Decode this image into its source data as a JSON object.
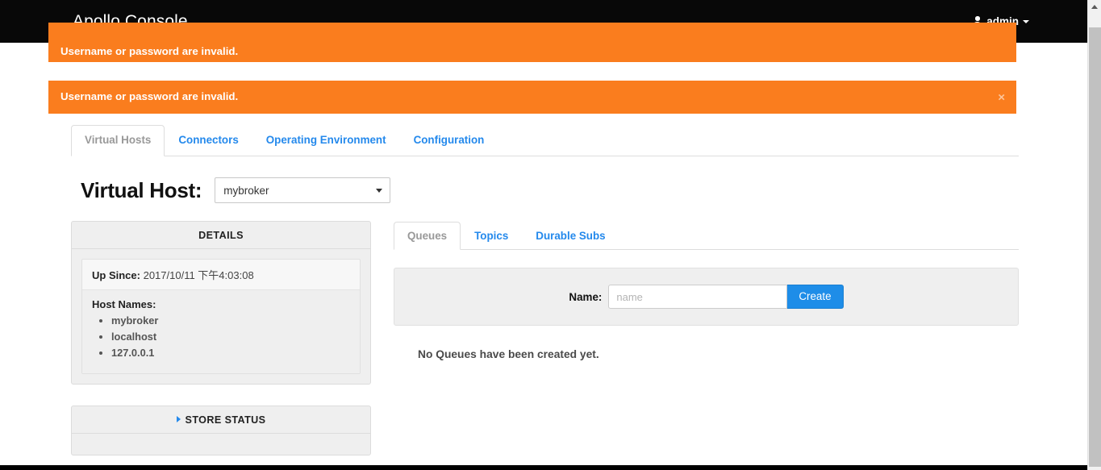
{
  "navbar": {
    "brand": "Apollo Console",
    "user_label": "admin",
    "user_icon": "user-icon",
    "caret_icon": "chevron-down-icon"
  },
  "alerts": [
    {
      "message": "Username or password are invalid.",
      "close_label": "×",
      "color": "#FA7D1E"
    },
    {
      "message": "Username or password are invalid.",
      "close_label": "×",
      "color": "#FA7D1E"
    }
  ],
  "main_tabs": [
    {
      "label": "Virtual Hosts",
      "active": true
    },
    {
      "label": "Connectors",
      "active": false
    },
    {
      "label": "Operating Environment",
      "active": false
    },
    {
      "label": "Configuration",
      "active": false
    }
  ],
  "vhost": {
    "title": "Virtual Host:",
    "selected": "mybroker",
    "options": [
      "mybroker"
    ]
  },
  "details_panel": {
    "heading": "DETAILS",
    "up_since_label": "Up Since:",
    "up_since_value": "2017/10/11 下午4:03:08",
    "host_names_label": "Host Names:",
    "host_names": [
      "mybroker",
      "localhost",
      "127.0.0.1"
    ]
  },
  "store_panel": {
    "heading": "STORE STATUS",
    "toggle_icon": "triangle-right-icon"
  },
  "inner_tabs": [
    {
      "label": "Queues",
      "active": true
    },
    {
      "label": "Topics",
      "active": false
    },
    {
      "label": "Durable Subs",
      "active": false
    }
  ],
  "create_form": {
    "name_label": "Name:",
    "name_value": "",
    "name_placeholder": "name",
    "create_label": "Create"
  },
  "empty_state": {
    "message": "No Queues have been created yet."
  },
  "scrollbar": {
    "up_arrow_icon": "triangle-up-icon"
  },
  "colors": {
    "navbar_bg": "#080808",
    "alert_bg": "#FA7D1E",
    "link_blue": "#2489EC",
    "button_blue": "#1E8DE8",
    "panel_bg": "#efefef"
  }
}
